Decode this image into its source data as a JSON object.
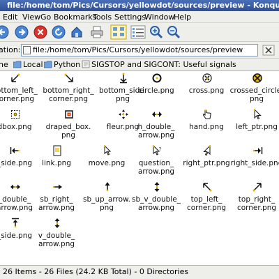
{
  "window": {
    "title": "file:/home/tom/Pics/Cursors/yellowdot/sources/preview - Konqueror"
  },
  "menu": [
    "Edit",
    "View",
    "Go",
    "Bookmarks",
    "Tools",
    "Settings",
    "Window",
    "Help"
  ],
  "toolbar": {
    "buttons": [
      "back-icon",
      "forward-icon",
      "stop-icon",
      "reload-icon",
      "home-icon",
      "print-icon",
      "icon-view-icon",
      "detail-view-icon",
      "zoom-in-icon",
      "zoom-out-icon"
    ]
  },
  "location": {
    "label": "ation:",
    "value": "file:/home/tom/Pics/Cursors/yellowdot/sources/preview"
  },
  "bookmarks": [
    "ne",
    "Local",
    "Python",
    "SIGSTOP and SIGCONT: Useful signals"
  ],
  "files": [
    {
      "name": "bottom_left_\ncorner.png",
      "icon": "arrow-bottom-left-cursor"
    },
    {
      "name": "bottom_right_\ncorner.png",
      "icon": "arrow-bottom-right-cursor"
    },
    {
      "name": "bottom_side.\npng",
      "icon": "arrow-down-cursor"
    },
    {
      "name": "circle.png",
      "icon": "circle-cursor"
    },
    {
      "name": "cross.png",
      "icon": "cross-cursor"
    },
    {
      "name": "crossed_circle.\npng",
      "icon": "crossed-circle-cursor"
    },
    {
      "name": "dbox.png",
      "icon": "dotbox-cursor"
    },
    {
      "name": "draped_box.\npng",
      "icon": "draped-box-cursor"
    },
    {
      "name": "fleur.png",
      "icon": "fleur-cursor"
    },
    {
      "name": "h_double_\narrow.png",
      "icon": "h-double-arrow-cursor"
    },
    {
      "name": "hand.png",
      "icon": "hand-cursor"
    },
    {
      "name": "left_ptr.png",
      "icon": "left-ptr-cursor"
    },
    {
      "name": "_side.png",
      "icon": "left-side-cursor"
    },
    {
      "name": "link.png",
      "icon": "link-cursor"
    },
    {
      "name": "move.png",
      "icon": "move-cursor"
    },
    {
      "name": "question_\narrow.png",
      "icon": "question-arrow-cursor"
    },
    {
      "name": "right_ptr.png",
      "icon": "right-ptr-cursor"
    },
    {
      "name": "right_side.png",
      "icon": "right-side-cursor"
    },
    {
      "name": "_double_\narrow.png",
      "icon": "sb-h-double-arrow-cursor"
    },
    {
      "name": "sb_right_\narrow.png",
      "icon": "sb-right-arrow-cursor"
    },
    {
      "name": "sb_up_arrow.\npng",
      "icon": "sb-up-arrow-cursor"
    },
    {
      "name": "sb_v_double_\narrow.png",
      "icon": "sb-v-double-arrow-cursor"
    },
    {
      "name": "top_left_\ncorner.png",
      "icon": "top-left-corner-cursor"
    },
    {
      "name": "top_right_\ncorner.png",
      "icon": "top-right-corner-cursor"
    },
    {
      "name": "_side.png",
      "icon": "top-side-cursor"
    },
    {
      "name": "v_double_\narrow.png",
      "icon": "v-double-arrow-cursor"
    }
  ],
  "status": "26 Items - 26 Files (24.2 KB Total) - 0 Directories",
  "colors": {
    "titlebar": "#3a5fa8",
    "chrome": "#eeeeea",
    "accent": "#e6b800"
  }
}
